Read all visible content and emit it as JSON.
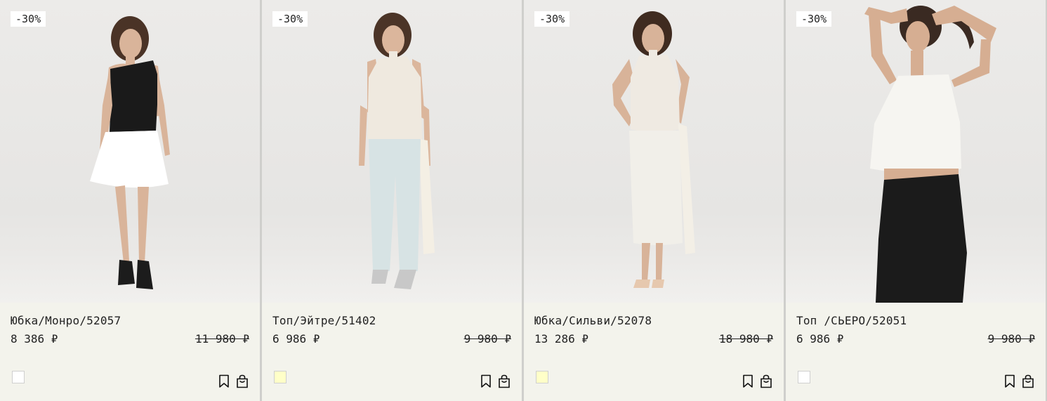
{
  "products": [
    {
      "badge": "-30%",
      "name": "Юбка/Монро/52057",
      "price": "8 386 ₽",
      "old_price": "11 980 ₽",
      "swatch_color": "#ffffff",
      "top_color": "#1a1a1a",
      "bottom_color": "#ffffff",
      "skin": "#d9b49a"
    },
    {
      "badge": "-30%",
      "name": "Топ/Эйтре/51402",
      "price": "6 986 ₽",
      "old_price": "9 980 ₽",
      "swatch_color": "#ffffc8",
      "top_color": "#efe9df",
      "bottom_color": "#d7e3e4",
      "skin": "#dbb69c"
    },
    {
      "badge": "-30%",
      "name": "Юбка/Сильви/52078",
      "price": "13 286 ₽",
      "old_price": "18 980 ₽",
      "swatch_color": "#ffffc8",
      "top_color": "#efeae2",
      "bottom_color": "#f1efe9",
      "skin": "#d8b399"
    },
    {
      "badge": "-30%",
      "name": "Топ /СЬЕРО/52051",
      "price": "6 986 ₽",
      "old_price": "9 980 ₽",
      "swatch_color": "#ffffff",
      "top_color": "#f6f5f1",
      "bottom_color": "#1b1b1b",
      "skin": "#d6ae92"
    }
  ],
  "icons": {
    "favorite": "bookmark-icon",
    "cart": "shopping-bag-icon"
  }
}
